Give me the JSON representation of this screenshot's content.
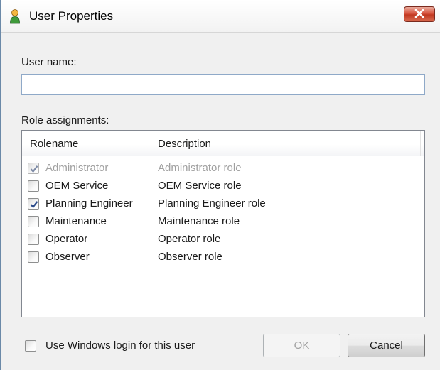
{
  "window": {
    "title": "User Properties",
    "icon": "user-icon",
    "close_icon": "close-x-icon"
  },
  "form": {
    "username_label": "User name:",
    "username_value": "",
    "roles_label": "Role assignments:"
  },
  "roles_table": {
    "columns": [
      "Rolename",
      "Description"
    ],
    "rows": [
      {
        "name": "Administrator",
        "description": "Administrator role",
        "checked": true,
        "disabled": true
      },
      {
        "name": "OEM Service",
        "description": "OEM Service role",
        "checked": false,
        "disabled": false
      },
      {
        "name": "Planning Engineer",
        "description": "Planning Engineer role",
        "checked": true,
        "disabled": false
      },
      {
        "name": "Maintenance",
        "description": "Maintenance role",
        "checked": false,
        "disabled": false
      },
      {
        "name": "Operator",
        "description": "Operator role",
        "checked": false,
        "disabled": false
      },
      {
        "name": "Observer",
        "description": "Observer role",
        "checked": false,
        "disabled": false
      }
    ]
  },
  "footer": {
    "windows_login_label": "Use Windows login for this user",
    "windows_login_checked": false,
    "ok_label": "OK",
    "ok_enabled": false,
    "cancel_label": "Cancel"
  },
  "colors": {
    "close_button": "#c13820",
    "checkmark": "#2a4a8a",
    "disabled_text": "#a0a0a0"
  }
}
